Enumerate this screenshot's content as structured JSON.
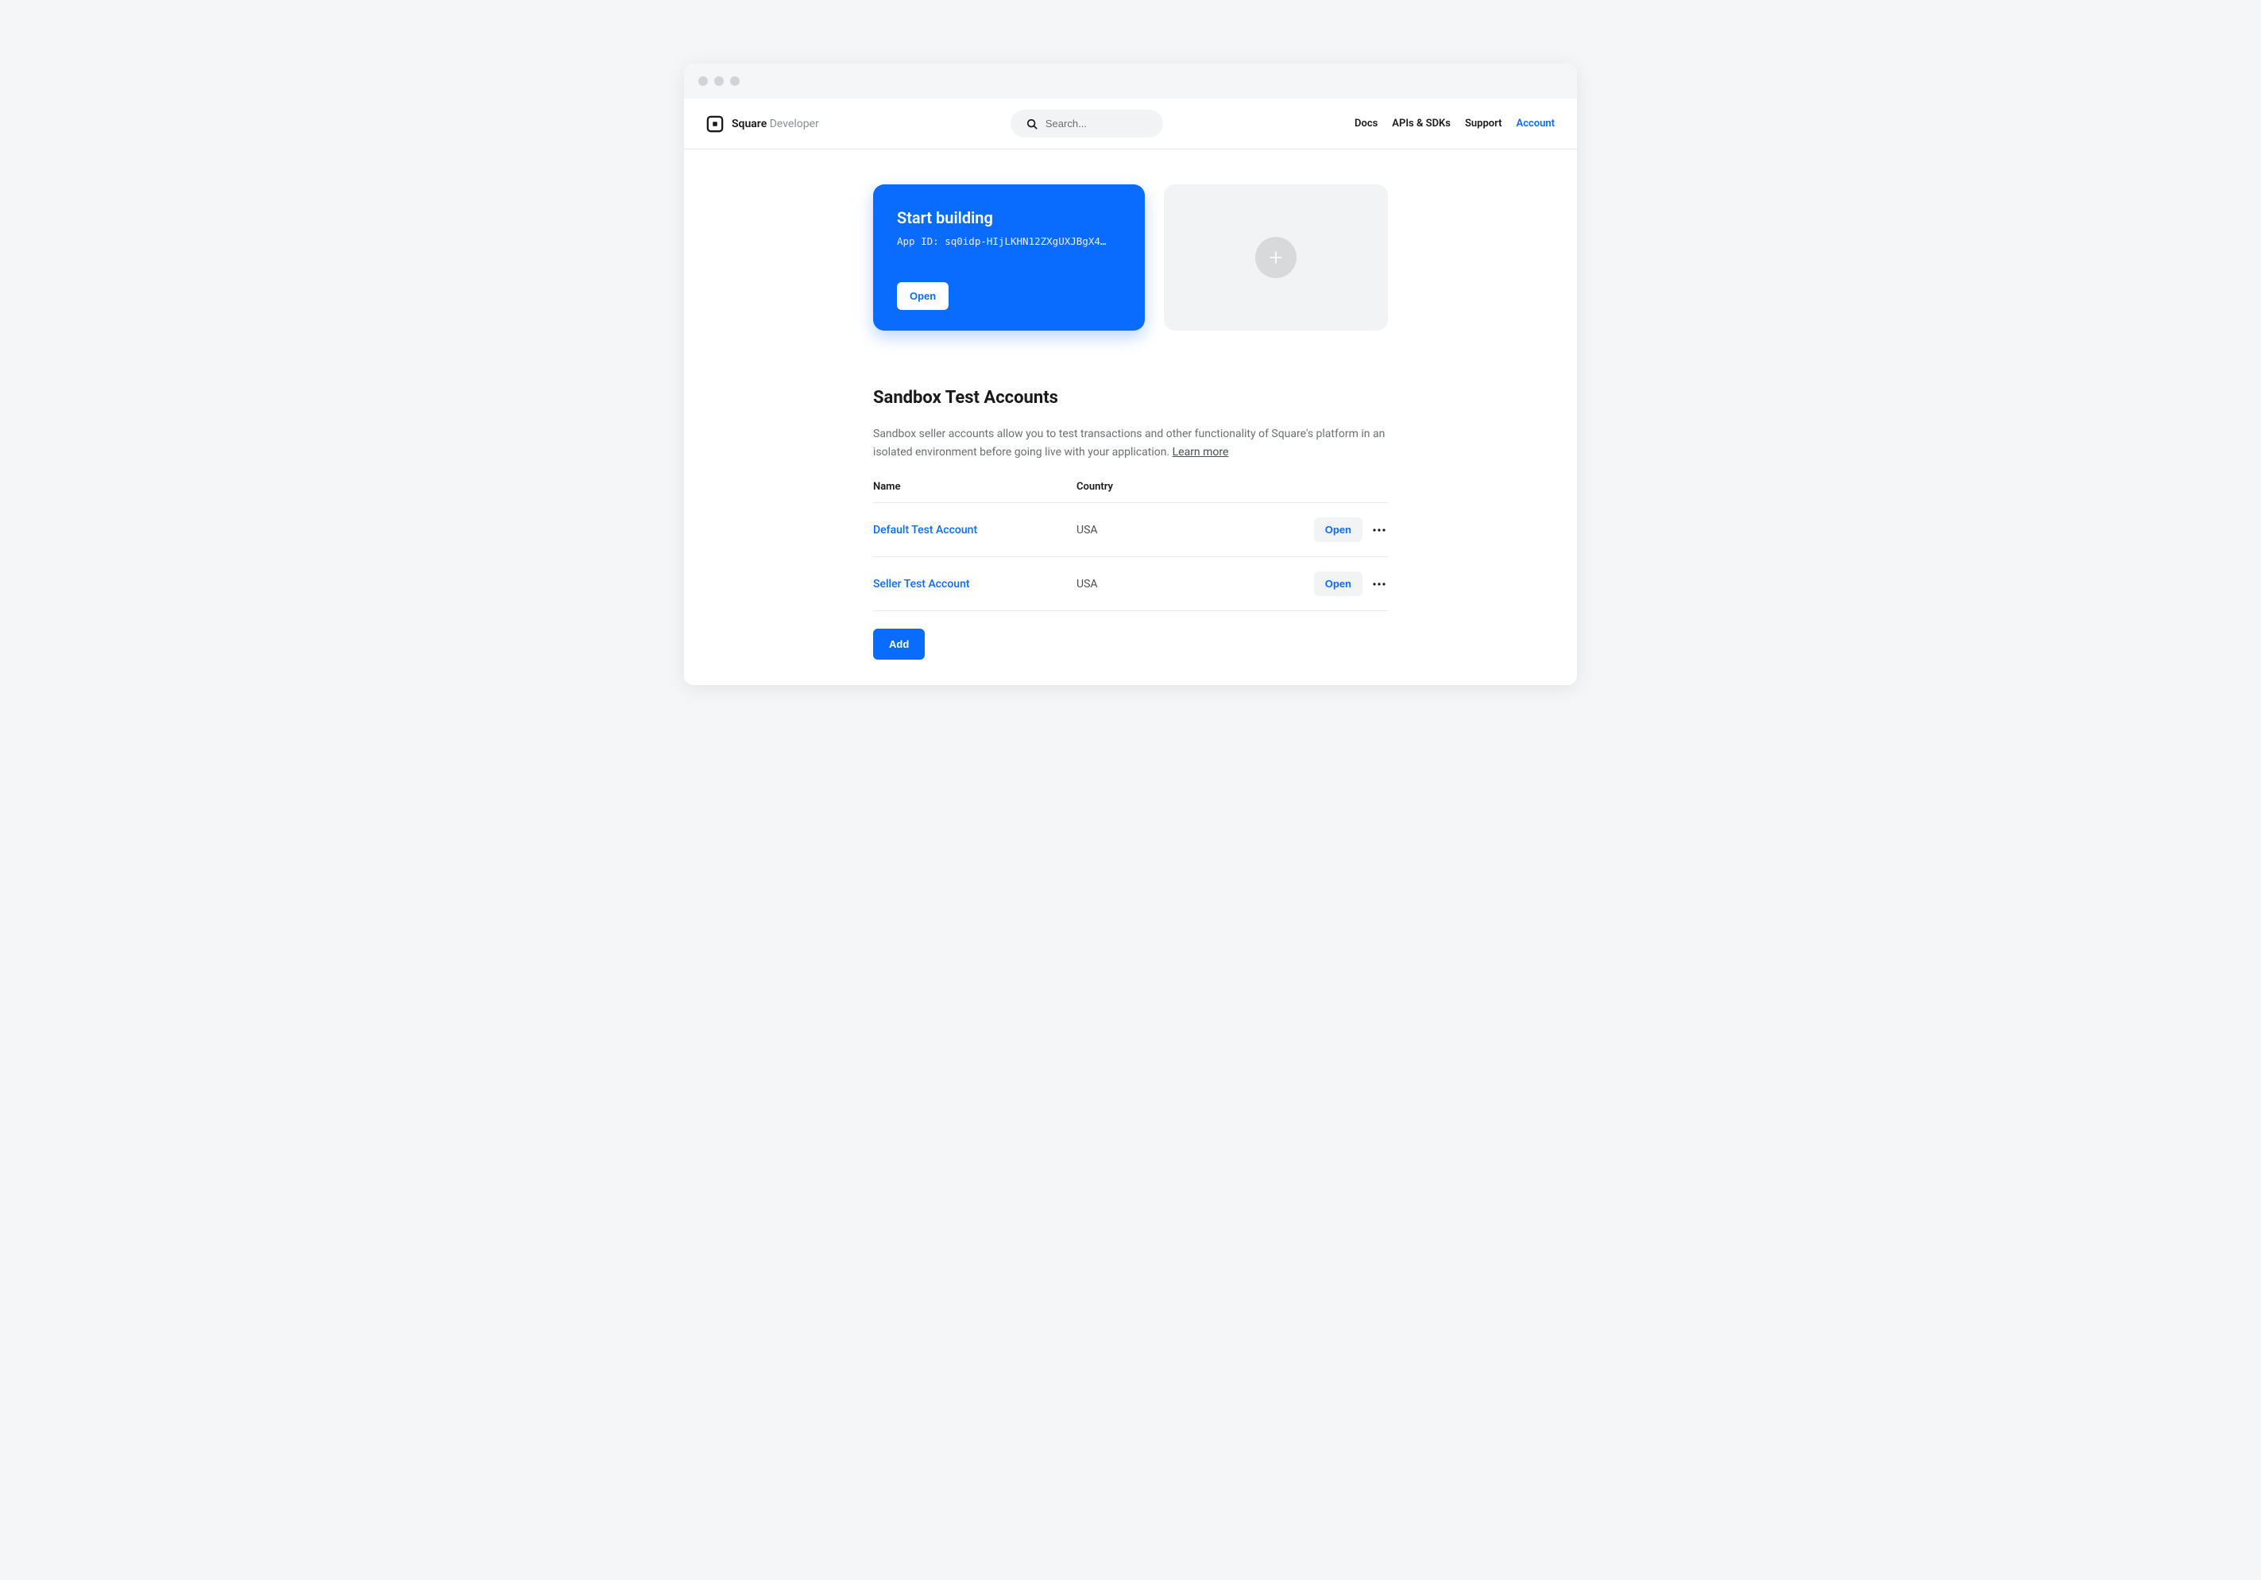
{
  "brand": {
    "main": "Square",
    "sub": "Developer"
  },
  "search": {
    "placeholder": "Search..."
  },
  "nav": {
    "docs": "Docs",
    "apis": "APIs & SDKs",
    "support": "Support",
    "account": "Account"
  },
  "appCard": {
    "title": "Start building",
    "appId": "App ID: sq0idp-HIjLKHN12ZXgUXJBgX4…",
    "openLabel": "Open"
  },
  "sandbox": {
    "title": "Sandbox Test Accounts",
    "description": "Sandbox seller accounts allow you to test transactions and other functionality of Square's platform in an isolated environment before going live with your application. ",
    "learnMore": "Learn more",
    "headers": {
      "name": "Name",
      "country": "Country"
    },
    "accounts": [
      {
        "name": "Default Test Account",
        "country": "USA",
        "openLabel": "Open"
      },
      {
        "name": "Seller Test Account",
        "country": "USA",
        "openLabel": "Open"
      }
    ],
    "addLabel": "Add"
  }
}
